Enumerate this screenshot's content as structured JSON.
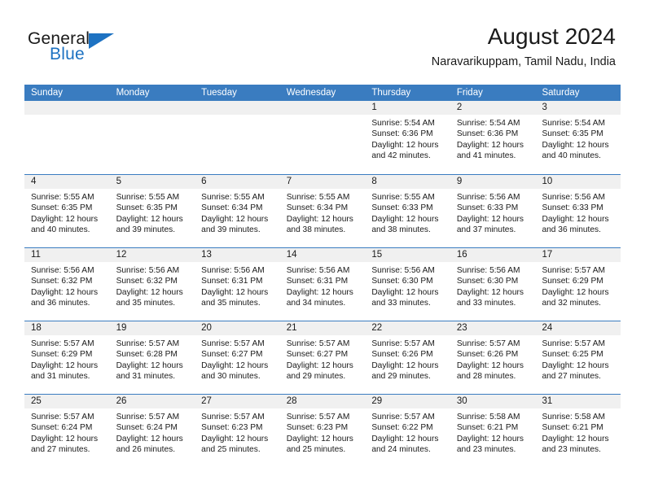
{
  "brand": {
    "line1": "General",
    "line2": "Blue",
    "accent_color": "#1d72c2",
    "triangle_icon": "brand-triangle-icon"
  },
  "header": {
    "title": "August 2024",
    "subtitle": "Naravarikuppam, Tamil Nadu, India"
  },
  "calendar": {
    "header_bg": "#3a7cc0",
    "day_band_bg": "#f0f0f0",
    "weekday_headers": [
      "Sunday",
      "Monday",
      "Tuesday",
      "Wednesday",
      "Thursday",
      "Friday",
      "Saturday"
    ],
    "weeks": [
      [
        {
          "day": "",
          "sunrise": "",
          "sunset": "",
          "daylight1": "",
          "daylight2": "",
          "empty": true
        },
        {
          "day": "",
          "sunrise": "",
          "sunset": "",
          "daylight1": "",
          "daylight2": "",
          "empty": true
        },
        {
          "day": "",
          "sunrise": "",
          "sunset": "",
          "daylight1": "",
          "daylight2": "",
          "empty": true
        },
        {
          "day": "",
          "sunrise": "",
          "sunset": "",
          "daylight1": "",
          "daylight2": "",
          "empty": true
        },
        {
          "day": "1",
          "sunrise": "Sunrise: 5:54 AM",
          "sunset": "Sunset: 6:36 PM",
          "daylight1": "Daylight: 12 hours",
          "daylight2": "and 42 minutes."
        },
        {
          "day": "2",
          "sunrise": "Sunrise: 5:54 AM",
          "sunset": "Sunset: 6:36 PM",
          "daylight1": "Daylight: 12 hours",
          "daylight2": "and 41 minutes."
        },
        {
          "day": "3",
          "sunrise": "Sunrise: 5:54 AM",
          "sunset": "Sunset: 6:35 PM",
          "daylight1": "Daylight: 12 hours",
          "daylight2": "and 40 minutes."
        }
      ],
      [
        {
          "day": "4",
          "sunrise": "Sunrise: 5:55 AM",
          "sunset": "Sunset: 6:35 PM",
          "daylight1": "Daylight: 12 hours",
          "daylight2": "and 40 minutes."
        },
        {
          "day": "5",
          "sunrise": "Sunrise: 5:55 AM",
          "sunset": "Sunset: 6:35 PM",
          "daylight1": "Daylight: 12 hours",
          "daylight2": "and 39 minutes."
        },
        {
          "day": "6",
          "sunrise": "Sunrise: 5:55 AM",
          "sunset": "Sunset: 6:34 PM",
          "daylight1": "Daylight: 12 hours",
          "daylight2": "and 39 minutes."
        },
        {
          "day": "7",
          "sunrise": "Sunrise: 5:55 AM",
          "sunset": "Sunset: 6:34 PM",
          "daylight1": "Daylight: 12 hours",
          "daylight2": "and 38 minutes."
        },
        {
          "day": "8",
          "sunrise": "Sunrise: 5:55 AM",
          "sunset": "Sunset: 6:33 PM",
          "daylight1": "Daylight: 12 hours",
          "daylight2": "and 38 minutes."
        },
        {
          "day": "9",
          "sunrise": "Sunrise: 5:56 AM",
          "sunset": "Sunset: 6:33 PM",
          "daylight1": "Daylight: 12 hours",
          "daylight2": "and 37 minutes."
        },
        {
          "day": "10",
          "sunrise": "Sunrise: 5:56 AM",
          "sunset": "Sunset: 6:33 PM",
          "daylight1": "Daylight: 12 hours",
          "daylight2": "and 36 minutes."
        }
      ],
      [
        {
          "day": "11",
          "sunrise": "Sunrise: 5:56 AM",
          "sunset": "Sunset: 6:32 PM",
          "daylight1": "Daylight: 12 hours",
          "daylight2": "and 36 minutes."
        },
        {
          "day": "12",
          "sunrise": "Sunrise: 5:56 AM",
          "sunset": "Sunset: 6:32 PM",
          "daylight1": "Daylight: 12 hours",
          "daylight2": "and 35 minutes."
        },
        {
          "day": "13",
          "sunrise": "Sunrise: 5:56 AM",
          "sunset": "Sunset: 6:31 PM",
          "daylight1": "Daylight: 12 hours",
          "daylight2": "and 35 minutes."
        },
        {
          "day": "14",
          "sunrise": "Sunrise: 5:56 AM",
          "sunset": "Sunset: 6:31 PM",
          "daylight1": "Daylight: 12 hours",
          "daylight2": "and 34 minutes."
        },
        {
          "day": "15",
          "sunrise": "Sunrise: 5:56 AM",
          "sunset": "Sunset: 6:30 PM",
          "daylight1": "Daylight: 12 hours",
          "daylight2": "and 33 minutes."
        },
        {
          "day": "16",
          "sunrise": "Sunrise: 5:56 AM",
          "sunset": "Sunset: 6:30 PM",
          "daylight1": "Daylight: 12 hours",
          "daylight2": "and 33 minutes."
        },
        {
          "day": "17",
          "sunrise": "Sunrise: 5:57 AM",
          "sunset": "Sunset: 6:29 PM",
          "daylight1": "Daylight: 12 hours",
          "daylight2": "and 32 minutes."
        }
      ],
      [
        {
          "day": "18",
          "sunrise": "Sunrise: 5:57 AM",
          "sunset": "Sunset: 6:29 PM",
          "daylight1": "Daylight: 12 hours",
          "daylight2": "and 31 minutes."
        },
        {
          "day": "19",
          "sunrise": "Sunrise: 5:57 AM",
          "sunset": "Sunset: 6:28 PM",
          "daylight1": "Daylight: 12 hours",
          "daylight2": "and 31 minutes."
        },
        {
          "day": "20",
          "sunrise": "Sunrise: 5:57 AM",
          "sunset": "Sunset: 6:27 PM",
          "daylight1": "Daylight: 12 hours",
          "daylight2": "and 30 minutes."
        },
        {
          "day": "21",
          "sunrise": "Sunrise: 5:57 AM",
          "sunset": "Sunset: 6:27 PM",
          "daylight1": "Daylight: 12 hours",
          "daylight2": "and 29 minutes."
        },
        {
          "day": "22",
          "sunrise": "Sunrise: 5:57 AM",
          "sunset": "Sunset: 6:26 PM",
          "daylight1": "Daylight: 12 hours",
          "daylight2": "and 29 minutes."
        },
        {
          "day": "23",
          "sunrise": "Sunrise: 5:57 AM",
          "sunset": "Sunset: 6:26 PM",
          "daylight1": "Daylight: 12 hours",
          "daylight2": "and 28 minutes."
        },
        {
          "day": "24",
          "sunrise": "Sunrise: 5:57 AM",
          "sunset": "Sunset: 6:25 PM",
          "daylight1": "Daylight: 12 hours",
          "daylight2": "and 27 minutes."
        }
      ],
      [
        {
          "day": "25",
          "sunrise": "Sunrise: 5:57 AM",
          "sunset": "Sunset: 6:24 PM",
          "daylight1": "Daylight: 12 hours",
          "daylight2": "and 27 minutes."
        },
        {
          "day": "26",
          "sunrise": "Sunrise: 5:57 AM",
          "sunset": "Sunset: 6:24 PM",
          "daylight1": "Daylight: 12 hours",
          "daylight2": "and 26 minutes."
        },
        {
          "day": "27",
          "sunrise": "Sunrise: 5:57 AM",
          "sunset": "Sunset: 6:23 PM",
          "daylight1": "Daylight: 12 hours",
          "daylight2": "and 25 minutes."
        },
        {
          "day": "28",
          "sunrise": "Sunrise: 5:57 AM",
          "sunset": "Sunset: 6:23 PM",
          "daylight1": "Daylight: 12 hours",
          "daylight2": "and 25 minutes."
        },
        {
          "day": "29",
          "sunrise": "Sunrise: 5:57 AM",
          "sunset": "Sunset: 6:22 PM",
          "daylight1": "Daylight: 12 hours",
          "daylight2": "and 24 minutes."
        },
        {
          "day": "30",
          "sunrise": "Sunrise: 5:58 AM",
          "sunset": "Sunset: 6:21 PM",
          "daylight1": "Daylight: 12 hours",
          "daylight2": "and 23 minutes."
        },
        {
          "day": "31",
          "sunrise": "Sunrise: 5:58 AM",
          "sunset": "Sunset: 6:21 PM",
          "daylight1": "Daylight: 12 hours",
          "daylight2": "and 23 minutes."
        }
      ]
    ]
  }
}
